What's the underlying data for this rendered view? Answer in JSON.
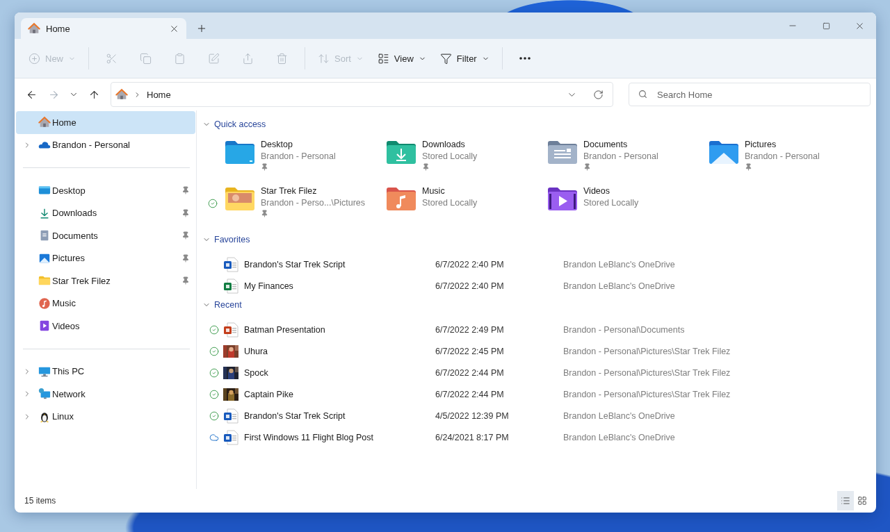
{
  "tabs": [
    {
      "label": "Home",
      "selected": true
    }
  ],
  "toolbar": [
    {
      "kind": "new",
      "label": "New",
      "disabled": true
    },
    {
      "kind": "cut",
      "disabled": true
    },
    {
      "kind": "copy",
      "disabled": true
    },
    {
      "kind": "paste",
      "disabled": true
    },
    {
      "kind": "rename",
      "disabled": true
    },
    {
      "kind": "share",
      "disabled": true
    },
    {
      "kind": "delete",
      "disabled": true
    },
    {
      "kind": "sort",
      "label": "Sort",
      "disabled": true
    },
    {
      "kind": "view",
      "label": "View",
      "disabled": false
    },
    {
      "kind": "filter",
      "label": "Filter",
      "disabled": false
    },
    {
      "kind": "more",
      "disabled": false
    }
  ],
  "nav": {
    "forward_disabled": true
  },
  "address": {
    "crumbs": [
      "Home"
    ]
  },
  "search": {
    "placeholder": "Search Home"
  },
  "sidebar": {
    "groups": [
      [
        {
          "kind": "home",
          "label": "Home",
          "selected": true,
          "expandable": false,
          "pinned": false
        },
        {
          "kind": "cloud",
          "label": "Brandon - Personal",
          "selected": false,
          "expandable": true,
          "pinned": false
        }
      ],
      [
        {
          "kind": "desktop",
          "label": "Desktop",
          "selected": false,
          "expandable": false,
          "pinned": true
        },
        {
          "kind": "downloads",
          "label": "Downloads",
          "selected": false,
          "expandable": false,
          "pinned": true
        },
        {
          "kind": "documents",
          "label": "Documents",
          "selected": false,
          "expandable": false,
          "pinned": true
        },
        {
          "kind": "pictures",
          "label": "Pictures",
          "selected": false,
          "expandable": false,
          "pinned": true
        },
        {
          "kind": "folder",
          "label": "Star Trek Filez",
          "selected": false,
          "expandable": false,
          "pinned": true
        },
        {
          "kind": "music",
          "label": "Music",
          "selected": false,
          "expandable": false,
          "pinned": false
        },
        {
          "kind": "videos",
          "label": "Videos",
          "selected": false,
          "expandable": false,
          "pinned": false
        }
      ],
      [
        {
          "kind": "pc",
          "label": "This PC",
          "selected": false,
          "expandable": true,
          "pinned": false
        },
        {
          "kind": "network",
          "label": "Network",
          "selected": false,
          "expandable": true,
          "pinned": false
        },
        {
          "kind": "linux",
          "label": "Linux",
          "selected": false,
          "expandable": true,
          "pinned": false
        }
      ]
    ]
  },
  "quick_access": {
    "title": "Quick access",
    "expanded": true,
    "items": [
      {
        "kind": "desktop",
        "name": "Desktop",
        "location": "Brandon - Personal",
        "pinned": true,
        "synced": false
      },
      {
        "kind": "downloads",
        "name": "Downloads",
        "location": "Stored Locally",
        "pinned": true,
        "synced": false
      },
      {
        "kind": "documents",
        "name": "Documents",
        "location": "Brandon - Personal",
        "pinned": true,
        "synced": false
      },
      {
        "kind": "pictures",
        "name": "Pictures",
        "location": "Brandon - Personal",
        "pinned": true,
        "synced": false
      },
      {
        "kind": "folder",
        "name": "Star Trek Filez",
        "location": "Brandon - Perso...\\Pictures",
        "pinned": true,
        "synced": true
      },
      {
        "kind": "music",
        "name": "Music",
        "location": "Stored Locally",
        "pinned": false,
        "synced": false
      },
      {
        "kind": "videos",
        "name": "Videos",
        "location": "Stored Locally",
        "pinned": false,
        "synced": false
      }
    ]
  },
  "favorites": {
    "title": "Favorites",
    "expanded": true,
    "rows": [
      {
        "kind": "word",
        "name": "Brandon's Star Trek Script",
        "date": "6/7/2022 2:40 PM",
        "location": "Brandon LeBlanc's OneDrive",
        "synced": false,
        "online_only": false
      },
      {
        "kind": "excel",
        "name": "My Finances",
        "date": "6/7/2022 2:40 PM",
        "location": "Brandon LeBlanc's OneDrive",
        "synced": false,
        "online_only": false
      }
    ]
  },
  "recent": {
    "title": "Recent",
    "expanded": true,
    "rows": [
      {
        "kind": "powerpoint",
        "name": "Batman Presentation",
        "date": "6/7/2022 2:49 PM",
        "location": "Brandon - Personal\\Documents",
        "synced": true,
        "online_only": false
      },
      {
        "name": "Uhura",
        "date": "6/7/2022 2:45 PM",
        "location": "Brandon - Personal\\Pictures\\Star Trek Filez",
        "synced": true,
        "online_only": false
      },
      {
        "name": "Spock",
        "date": "6/7/2022 2:44 PM",
        "location": "Brandon - Personal\\Pictures\\Star Trek Filez",
        "synced": true,
        "online_only": false
      },
      {
        "name": "Captain Pike",
        "date": "6/7/2022 2:44 PM",
        "location": "Brandon - Personal\\Pictures\\Star Trek Filez",
        "synced": true,
        "online_only": false
      },
      {
        "kind": "word",
        "name": "Brandon's Star Trek Script",
        "date": "4/5/2022 12:39 PM",
        "location": "Brandon LeBlanc's OneDrive",
        "synced": true,
        "online_only": false
      },
      {
        "kind": "word",
        "name": "First Windows 11 Flight Blog Post",
        "date": "6/24/2021 8:17 PM",
        "location": "Brandon LeBlanc's OneDrive",
        "synced": false,
        "online_only": true
      }
    ]
  },
  "status_bar": {
    "count": "15 items",
    "view_buttons": [
      {
        "kind": "details",
        "selected": true
      },
      {
        "kind": "tiles",
        "selected": false
      }
    ]
  }
}
